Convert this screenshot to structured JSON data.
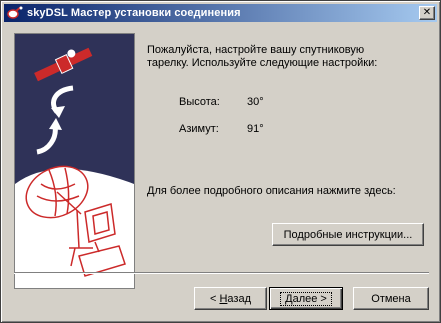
{
  "window": {
    "title": "skyDSL Мастер установки соединения",
    "close_label": "✕"
  },
  "content": {
    "intro_line1": "Пожалуйста, настройте вашу спутниковую",
    "intro_line2": "тарелку. Используйте следующие настройки:",
    "params": [
      {
        "label": "Высота:",
        "value": "30°"
      },
      {
        "label": "Азимут:",
        "value": "91°"
      }
    ],
    "details_prompt": "Для более подробного описания нажмите здесь:",
    "details_button": "Подробные инструкции..."
  },
  "buttons": {
    "back_prefix": "< ",
    "back_hotkey": "Н",
    "back_rest": "азад",
    "next_hotkey": "Д",
    "next_rest": "алее >",
    "cancel": "Отмена"
  },
  "colors": {
    "title_start": "#0a246a",
    "title_end": "#a6caf0",
    "panel_bg": "#2f3258",
    "accent_red": "#cc2a2a",
    "face": "#d4d0c8"
  }
}
